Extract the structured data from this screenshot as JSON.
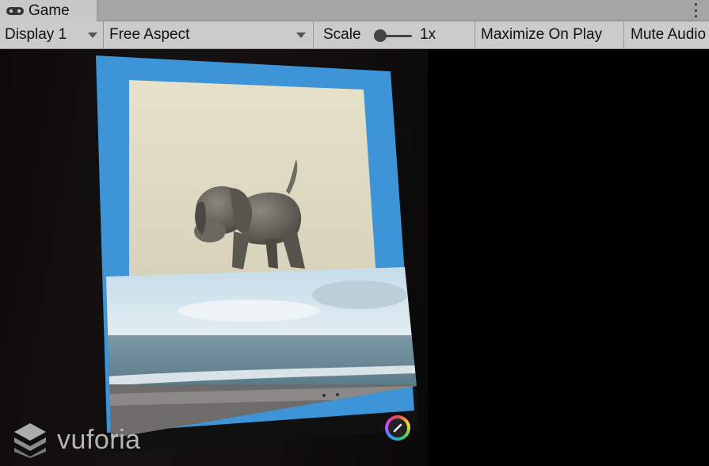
{
  "tab": {
    "title": "Game",
    "icon": "gamepad-icon"
  },
  "toolbar": {
    "display": "Display 1",
    "aspect": "Free Aspect",
    "scale_label": "Scale",
    "scale_value": "1x",
    "scale_slider_position": 0.1,
    "maximize": "Maximize On Play",
    "mute": "Mute Audio"
  },
  "view": {
    "watermark": "vuforia",
    "watermark_icon": "vuforia-logo-icon",
    "pencil_icon": "pencil-icon"
  },
  "colors": {
    "tab_bg": "#c8c8c8",
    "toolbar_bg": "#cbcbcb",
    "card_blue": "#3d94d6",
    "panel_cream": "#e2ddc5"
  }
}
